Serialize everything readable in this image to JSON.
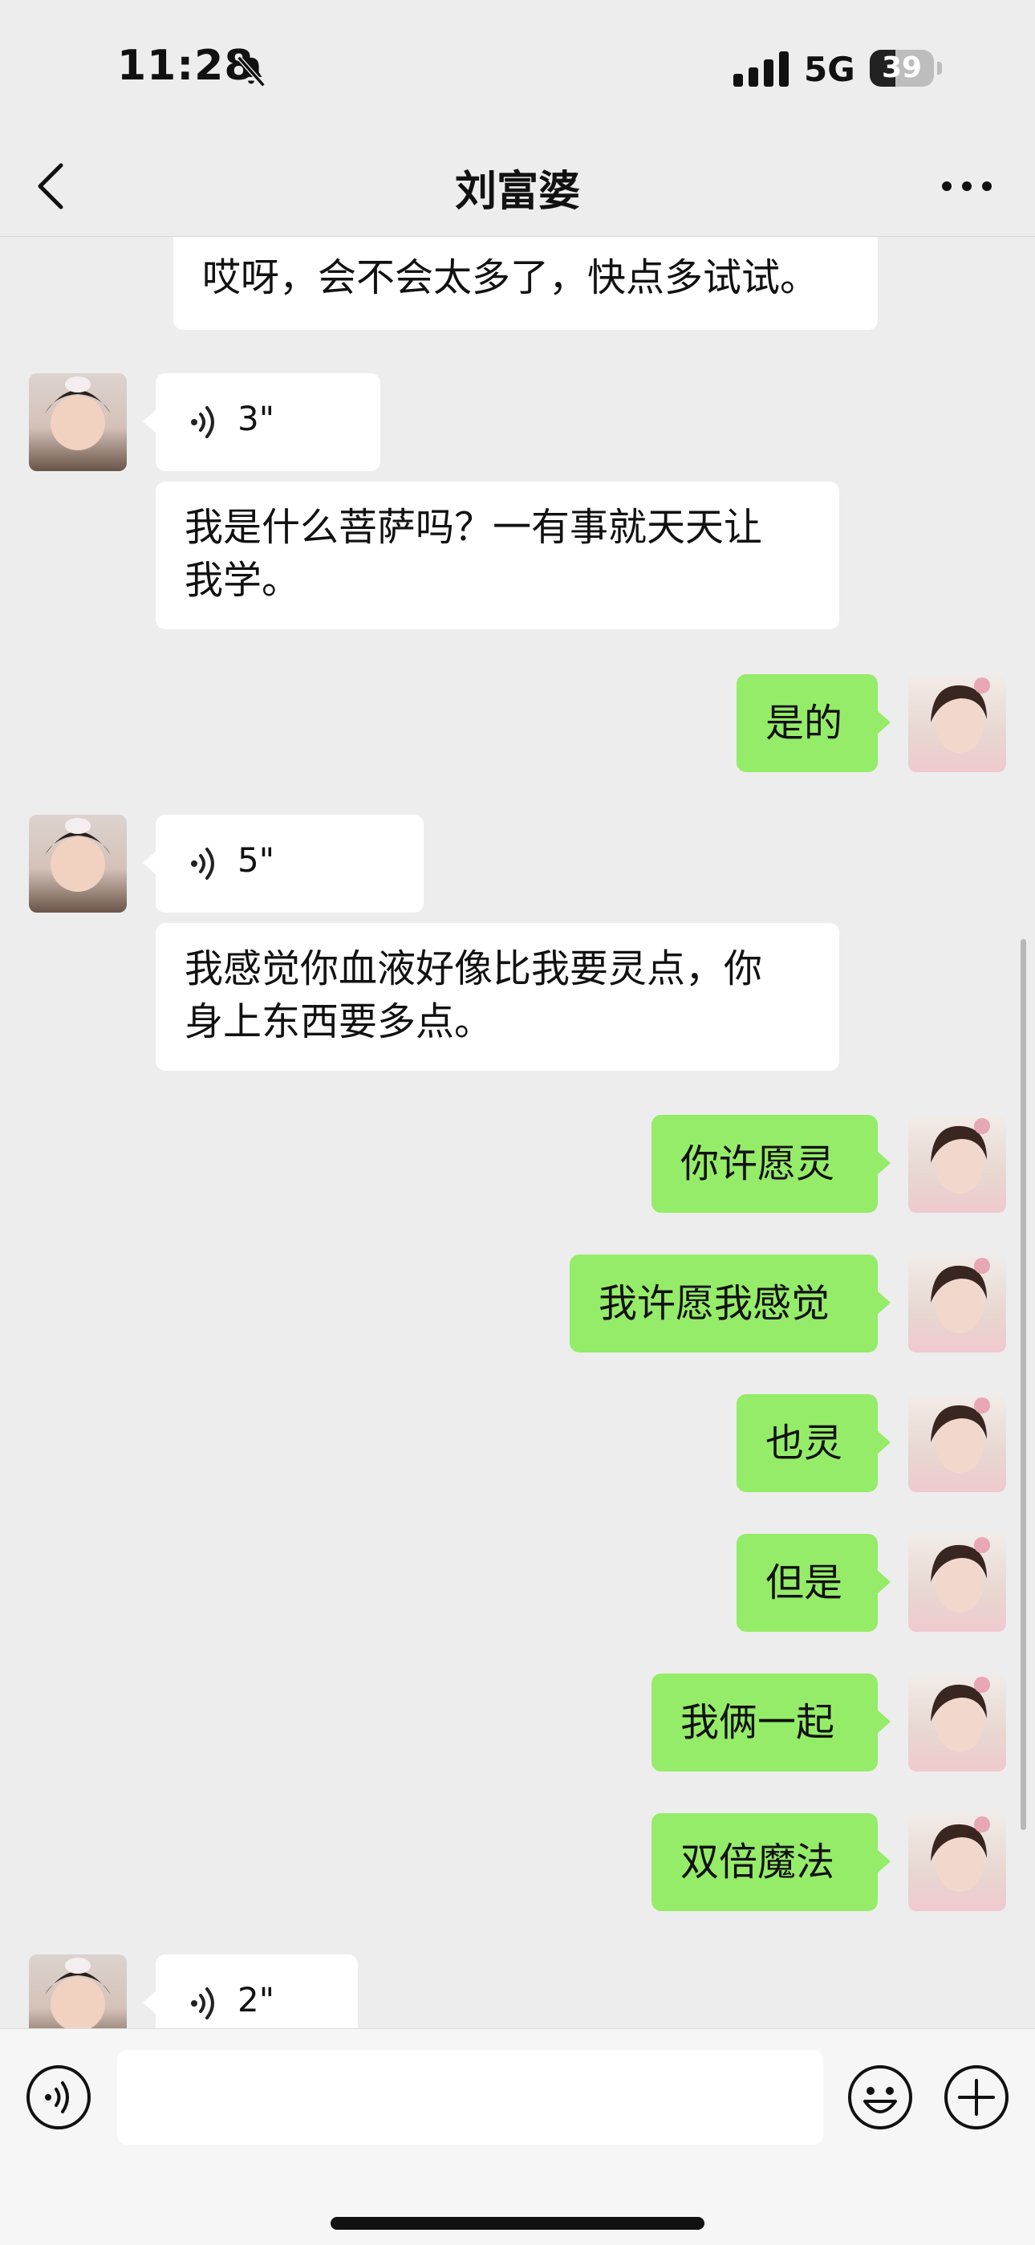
{
  "status_bar": {
    "time": "11:28",
    "network": "5G",
    "battery": "39"
  },
  "nav": {
    "title": "刘富婆"
  },
  "messages": [
    {
      "side": "in",
      "type": "text",
      "text": "哎呀，会不会太多了，快点多试试。"
    },
    {
      "side": "in",
      "type": "voice",
      "duration": "3\""
    },
    {
      "side": "in",
      "type": "text",
      "lines": [
        "我是什么菩萨吗？一有事就天天让",
        "我学。"
      ]
    },
    {
      "side": "out",
      "type": "text",
      "text": "是的"
    },
    {
      "side": "in",
      "type": "voice",
      "duration": "5\""
    },
    {
      "side": "in",
      "type": "text",
      "lines": [
        "我感觉你血液好像比我要灵点，你",
        "身上东西要多点。"
      ]
    },
    {
      "side": "out",
      "type": "text",
      "text": "你许愿灵"
    },
    {
      "side": "out",
      "type": "text",
      "text": "我许愿我感觉"
    },
    {
      "side": "out",
      "type": "text",
      "text": "也灵"
    },
    {
      "side": "out",
      "type": "text",
      "text": "但是"
    },
    {
      "side": "out",
      "type": "text",
      "text": "我俩一起"
    },
    {
      "side": "out",
      "type": "text",
      "text": "双倍魔法"
    },
    {
      "side": "in",
      "type": "voice",
      "duration": "2\""
    }
  ],
  "input_bar": {
    "voice_icon": "voice-mode-icon",
    "emoji_icon": "emoji-icon",
    "plus_icon": "plus-icon",
    "text": ""
  },
  "colors": {
    "background": "#ededed",
    "outgoing": "#95ec69",
    "incoming": "#ffffff"
  }
}
